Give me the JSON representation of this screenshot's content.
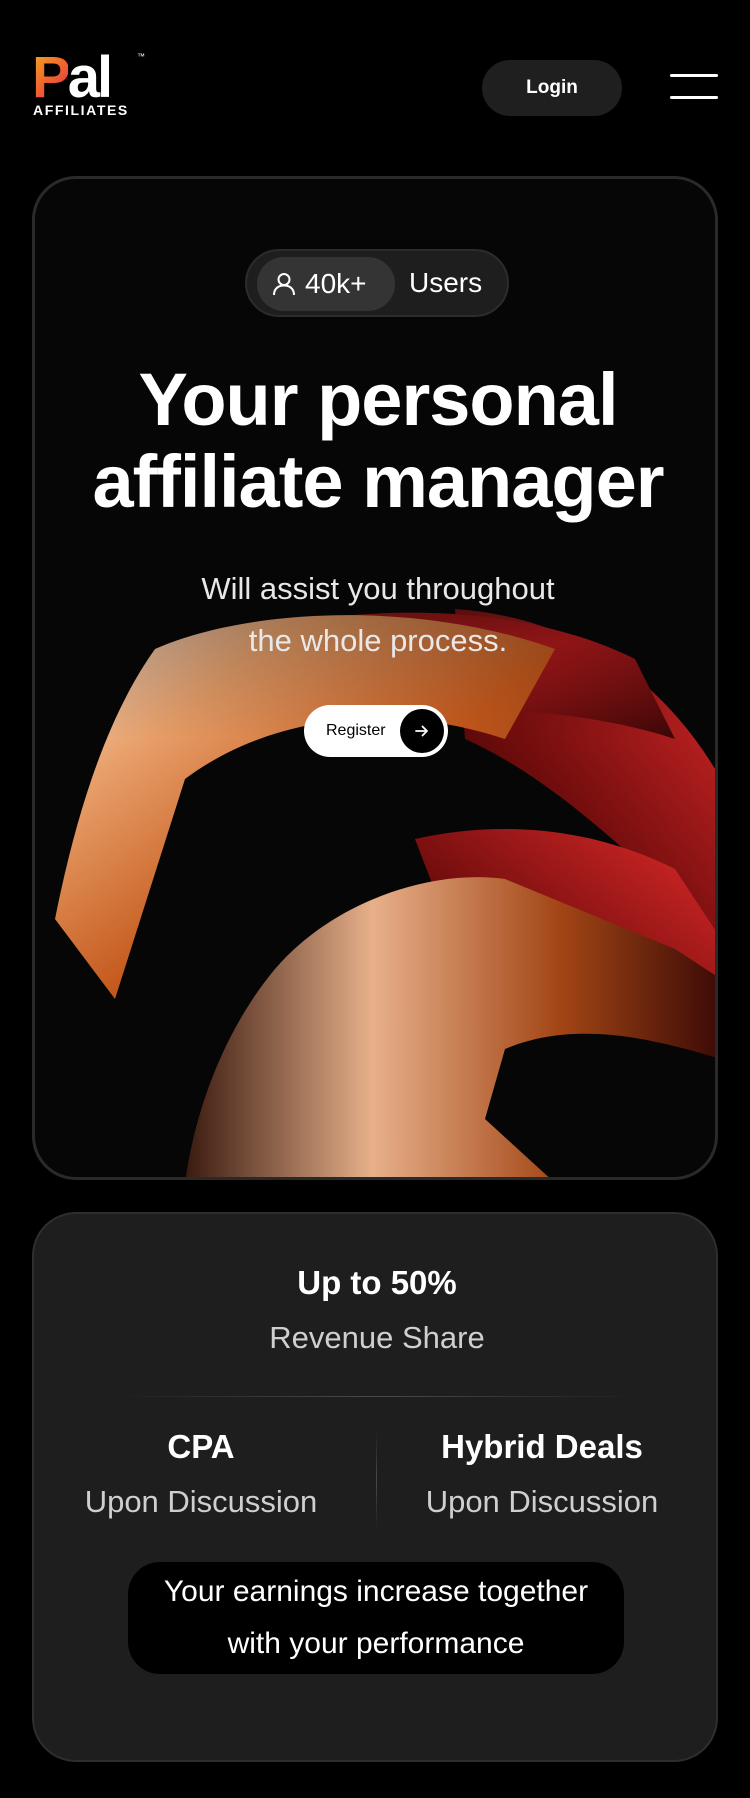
{
  "brand": {
    "logo_mark_p": "P",
    "logo_mark_rest": "al",
    "logo_tm": "™",
    "logo_sub": "AFFILIATES",
    "gradient_colors": [
      "#f6a623",
      "#f06a2a",
      "#e0245e"
    ]
  },
  "header": {
    "login_label": "Login",
    "menu_icon": "hamburger-menu-icon"
  },
  "hero": {
    "users_count": "40k+",
    "users_label": "Users",
    "user_icon": "user-icon",
    "title_lines": [
      "Your personal",
      "affiliate manager"
    ],
    "subtitle_lines": [
      "Will assist you throughout",
      "the whole process."
    ],
    "register_label": "Register",
    "register_icon": "arrow-right-icon"
  },
  "stats": {
    "main_value": "Up to 50%",
    "main_label": "Revenue Share",
    "columns": [
      {
        "title": "CPA",
        "label": "Upon Discussion"
      },
      {
        "title": "Hybrid Deals",
        "label": "Upon Discussion"
      }
    ],
    "earnings_lines": [
      "Your earnings increase together",
      "with your performance"
    ]
  }
}
